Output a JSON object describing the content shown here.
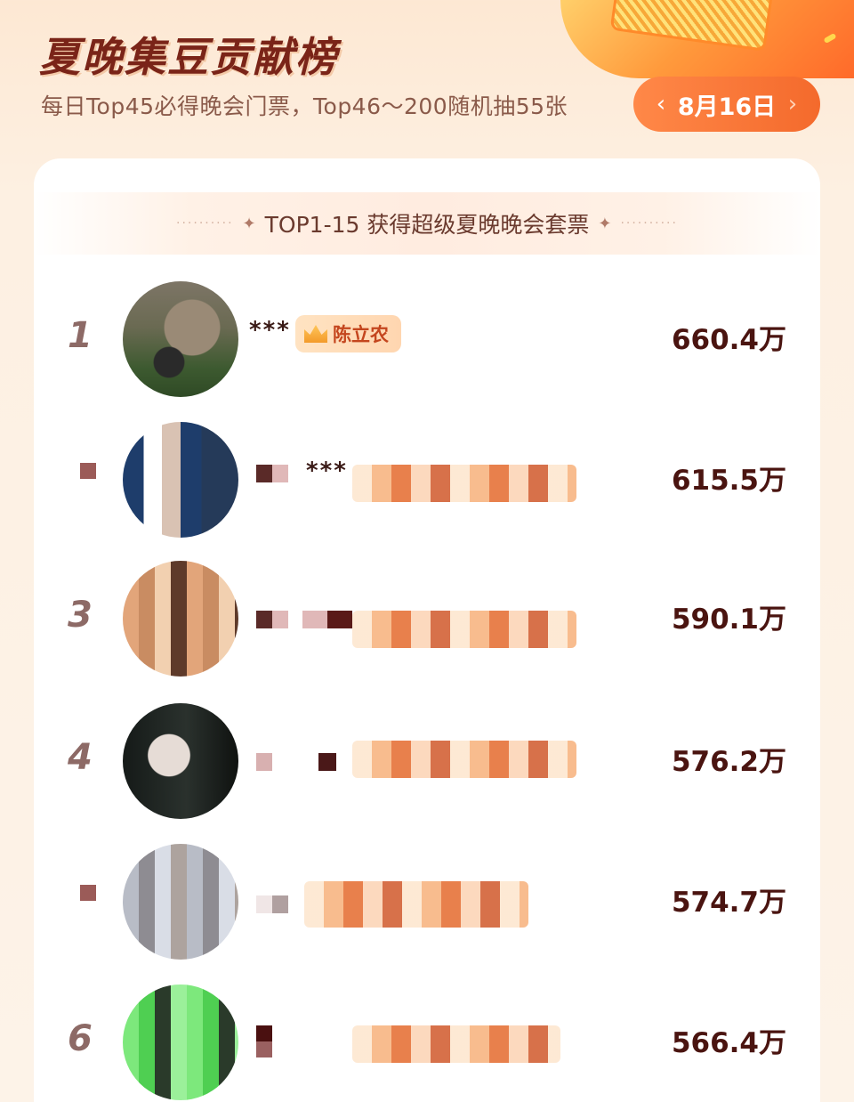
{
  "header": {
    "title": "夏晚集豆贡献榜",
    "subtitle": "每日Top45必得晚会门票，Top46～200随机抽55张",
    "date": "8月16日"
  },
  "section": {
    "label": "TOP1-15 获得超级夏晚晚会套票"
  },
  "rows": [
    {
      "rank": "1",
      "name": "***",
      "badge": "陈立农",
      "score": "660.4万"
    },
    {
      "rank": "",
      "name": "***",
      "badge": "",
      "score": "615.5万"
    },
    {
      "rank": "3",
      "name": "",
      "badge": "",
      "score": "590.1万"
    },
    {
      "rank": "4",
      "name": "",
      "badge": "",
      "score": "576.2万"
    },
    {
      "rank": "",
      "name": "",
      "badge": "",
      "score": "574.7万"
    },
    {
      "rank": "6",
      "name": "",
      "badge": "",
      "score": "566.4万"
    }
  ],
  "icons": {
    "prev": "chevron-left-icon",
    "next": "chevron-right-icon",
    "badge": "crown-icon"
  },
  "colors": {
    "accent": "#f46a2c",
    "title": "#7a2418",
    "score": "#4a1410"
  }
}
